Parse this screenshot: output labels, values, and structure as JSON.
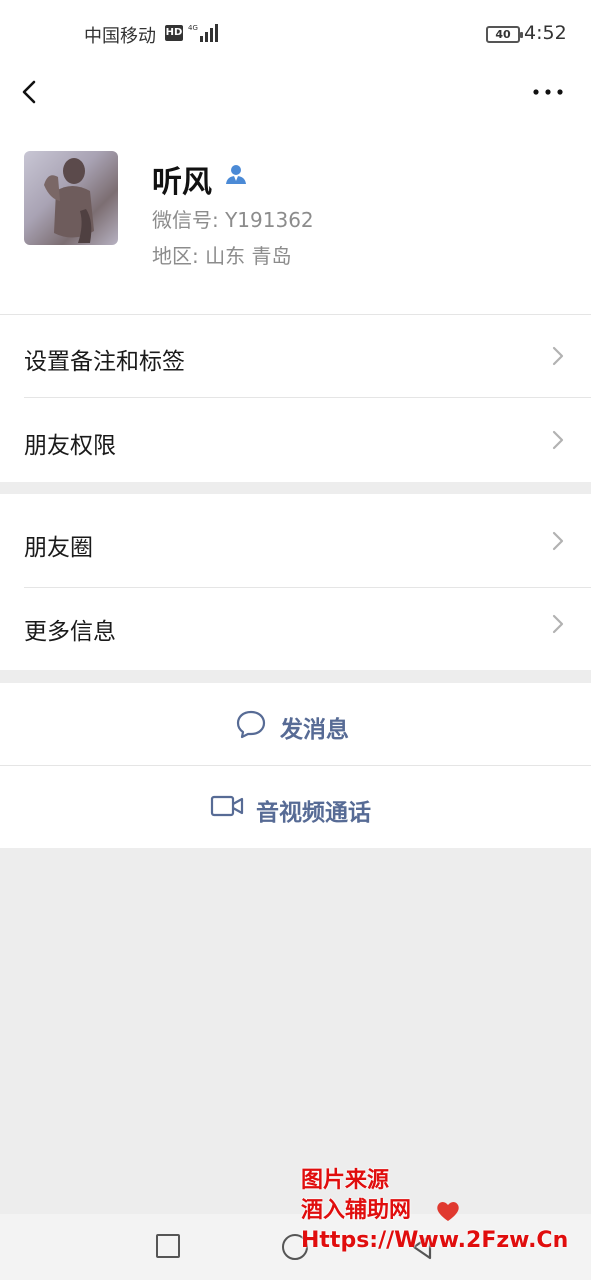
{
  "status_bar": {
    "carrier": "中国移动",
    "hd": "HD",
    "battery": "40",
    "time": "4:52"
  },
  "profile": {
    "name": "听风",
    "wechat_id": "微信号: Y191362",
    "region": "地区: 山东  青岛"
  },
  "settings": {
    "remark_tags": "设置备注和标签",
    "friend_permissions": "朋友权限"
  },
  "info": {
    "moments": "朋友圈",
    "more_info": "更多信息"
  },
  "actions": {
    "send_message": "发消息",
    "av_call": "音视频通话"
  },
  "watermark": {
    "line1": "图片来源",
    "line2": "酒入辅助网",
    "line3": "Https://Www.2Fzw.Cn"
  },
  "colors": {
    "link_blue": "#576b95",
    "verified_blue": "#4b8ad6",
    "watermark_red": "#e00d0d"
  }
}
